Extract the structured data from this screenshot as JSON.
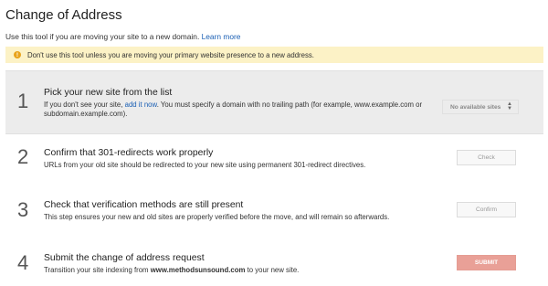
{
  "page": {
    "title": "Change of Address",
    "description": "Use this tool if you are moving your site to a new domain.",
    "learn_more": "Learn more"
  },
  "warning": {
    "icon": "alert-icon",
    "icon_glyph": "!",
    "text": "Don't use this tool unless you are moving your primary website presence to a new address."
  },
  "steps": [
    {
      "number": "1",
      "title": "Pick your new site from the list",
      "desc_before": "If you don't see your site,",
      "desc_link": "add it now",
      "desc_after": ". You must specify a domain with no trailing path (for example, www.example.com or subdomain.example.com).",
      "control": "No available sites"
    },
    {
      "number": "2",
      "title": "Confirm that 301-redirects work properly",
      "desc": "URLs from your old site should be redirected to your new site using permanent 301-redirect directives.",
      "button": "Check"
    },
    {
      "number": "3",
      "title": "Check that verification methods are still present",
      "desc": "This step ensures your new and old sites are properly verified before the move, and will remain so afterwards.",
      "button": "Confirm"
    },
    {
      "number": "4",
      "title": "Submit the change of address request",
      "desc_before": "Transition your site indexing from",
      "desc_domain": "www.methodsunsound.com",
      "desc_after": "to your new site.",
      "button": "SUBMIT"
    }
  ],
  "colors": {
    "warning_bg": "#fcf2c6",
    "warning_icon": "#e8a31b",
    "active_step_bg": "#ececec",
    "submit_button": "#e9a097",
    "link": "#1a5fb4"
  }
}
